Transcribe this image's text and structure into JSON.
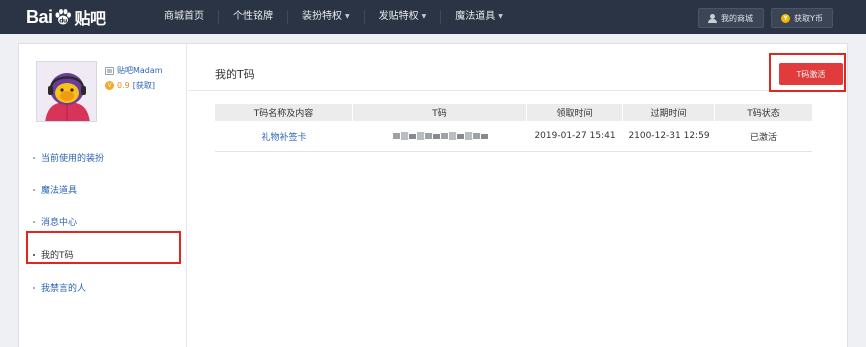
{
  "header": {
    "logo_text": "Bai",
    "logo_text2": "贴吧",
    "nav": [
      {
        "label": "商城首页",
        "has_caret": false
      },
      {
        "label": "个性铭牌",
        "has_caret": false
      },
      {
        "label": "装扮特权",
        "has_caret": true
      },
      {
        "label": "发贴特权",
        "has_caret": true
      },
      {
        "label": "魔法道具",
        "has_caret": true
      }
    ],
    "my_mall_label": "我的商城",
    "get_coins_label": "获取Y币",
    "coin_symbol": "Y"
  },
  "profile": {
    "username": "贴吧Madam",
    "level_symbol": "V",
    "level_value": "0.9",
    "get_link": "[获取]"
  },
  "sidebar": {
    "items": [
      {
        "label": "当前使用的装扮",
        "active": false
      },
      {
        "label": "魔法道具",
        "active": false
      },
      {
        "label": "消息中心",
        "active": false
      },
      {
        "label": "我的T码",
        "active": true
      },
      {
        "label": "我禁言的人",
        "active": false
      }
    ]
  },
  "content": {
    "title": "我的T码",
    "activate_button": "T码激活",
    "table": {
      "headers": [
        "T码名称及内容",
        "T码",
        "领取时间",
        "过期时间",
        "T码状态"
      ],
      "rows": [
        {
          "name": "礼物补签卡",
          "code": "",
          "received": "2019-01-27 15:41",
          "expires": "2100-12-31 12:59",
          "status": "已激活"
        }
      ]
    }
  },
  "colors": {
    "topbar": "#2a3445",
    "link": "#2d64b3",
    "accent_red": "#e23b3b",
    "annotation": "#e0261f"
  }
}
